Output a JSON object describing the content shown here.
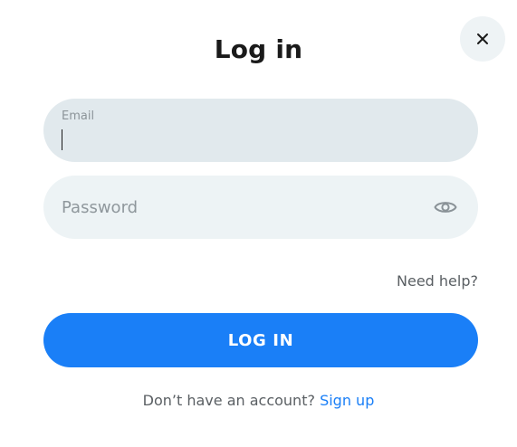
{
  "dialog": {
    "title": "Log in",
    "close_icon": "close-icon"
  },
  "email": {
    "label": "Email",
    "value": ""
  },
  "password": {
    "placeholder": "Password",
    "value": "",
    "toggle_icon": "eye-icon"
  },
  "help": {
    "label": "Need help?"
  },
  "login_button": {
    "label": "LOG IN"
  },
  "signup": {
    "prompt": "Don’t have an account?",
    "link_label": "Sign up"
  },
  "colors": {
    "accent": "#1a7ff7",
    "email_field_bg": "#e1e9ed",
    "password_field_bg": "#edf3f5",
    "close_button_bg": "#eef3f5"
  }
}
